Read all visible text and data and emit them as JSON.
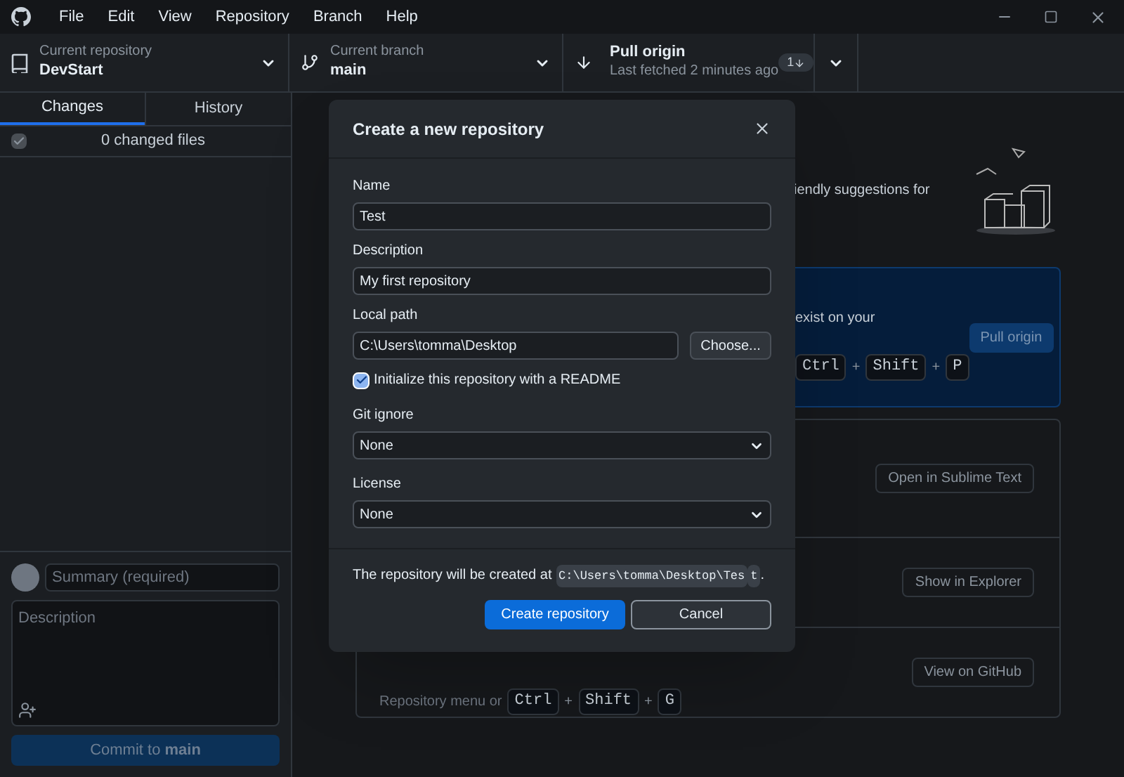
{
  "title_bar": {
    "menus": [
      "File",
      "Edit",
      "View",
      "Repository",
      "Branch",
      "Help"
    ]
  },
  "toolbar": {
    "repository": {
      "label": "Current repository",
      "value": "DevStart"
    },
    "branch": {
      "label": "Current branch",
      "value": "main"
    },
    "pull": {
      "title": "Pull origin",
      "subtitle": "Last fetched 2 minutes ago",
      "badge": "1"
    }
  },
  "sidebar": {
    "tabs": [
      {
        "label": "Changes",
        "selected": true
      },
      {
        "label": "History",
        "selected": false
      }
    ],
    "changes": {
      "checked": true,
      "label": "0 changed files"
    },
    "commit": {
      "summary_placeholder": "Summary (required)",
      "description_placeholder": "Description",
      "button": "Commit to **main**"
    }
  },
  "main": {
    "suggestion_text": "iendly suggestions for",
    "pull_card": {
      "text": "exist on your",
      "button": "Pull origin",
      "keys": [
        "Ctrl",
        "Shift",
        "P"
      ],
      "separator": "+"
    },
    "actions": [
      {
        "button": "Open in Sublime Text"
      },
      {
        "button": "Show in Explorer"
      },
      {
        "button": "View on GitHub",
        "hint": "Repository menu or",
        "keys": [
          "Ctrl",
          "Shift",
          "G"
        ],
        "separator": "+"
      }
    ]
  },
  "dialog": {
    "title": "Create a new repository",
    "fields": [
      {
        "kind": "text",
        "label": "Name",
        "value": "Test"
      },
      {
        "kind": "text",
        "label": "Description",
        "value": "My first repository"
      },
      {
        "kind": "path",
        "label": "Local path",
        "value": "C:\\Users\\tomma\\Desktop",
        "button": "Choose..."
      },
      {
        "kind": "checkbox",
        "label": "Initialize this repository with a README",
        "checked": true
      },
      {
        "kind": "select",
        "label": "Git ignore",
        "value": "None"
      },
      {
        "kind": "select",
        "label": "License",
        "value": "None"
      }
    ],
    "note": "The repository will be created at",
    "path_lines": [
      "C:\\Users\\tomma\\Desktop\\Tes",
      "t"
    ],
    "note_end": ".",
    "buttons": [
      {
        "label": "Create repository",
        "kind": "primary"
      },
      {
        "label": "Cancel",
        "kind": "secondary"
      }
    ]
  }
}
